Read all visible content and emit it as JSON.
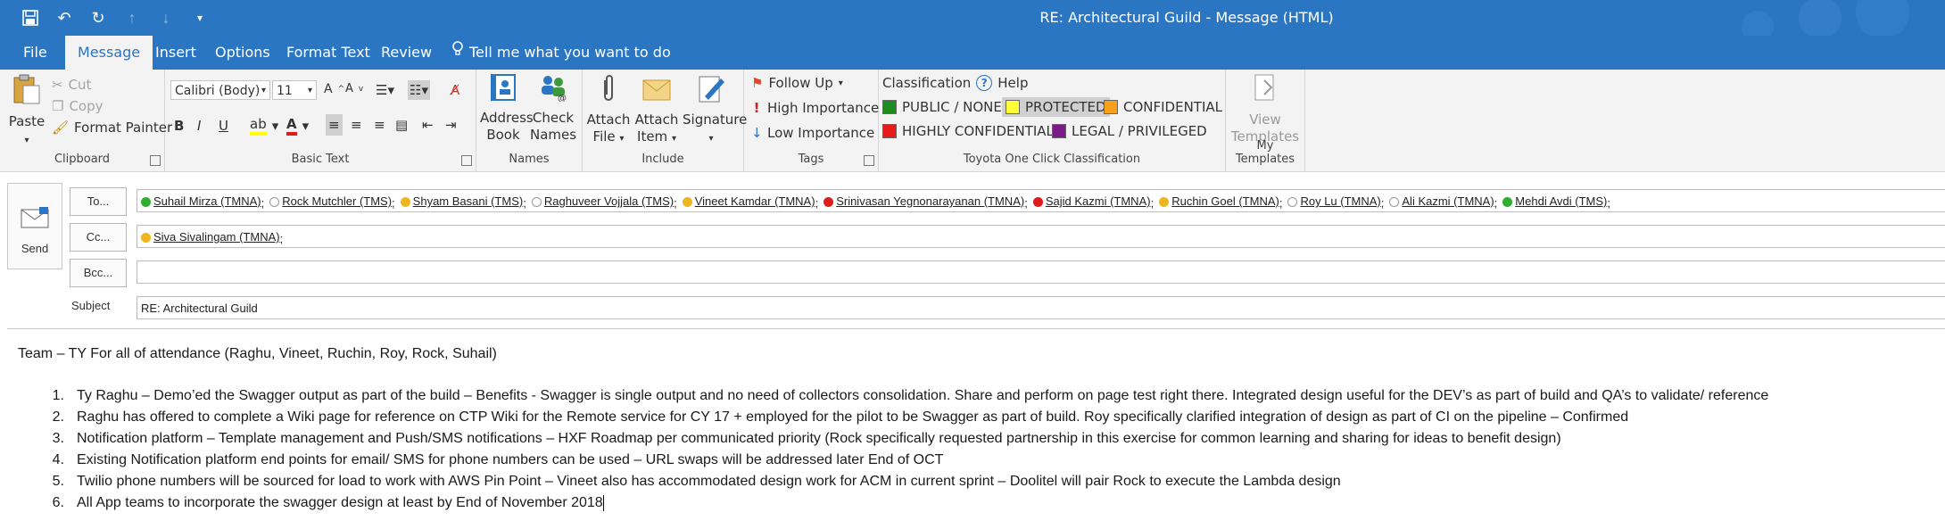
{
  "window": {
    "title": "RE: Architectural Guild  -  Message (HTML)"
  },
  "tabs": [
    "File",
    "Message",
    "Insert",
    "Options",
    "Format Text",
    "Review"
  ],
  "tell_me": "Tell me what you want to do",
  "ribbon": {
    "clipboard": {
      "paste": "Paste",
      "cut": "Cut",
      "copy": "Copy",
      "format_painter": "Format Painter",
      "label": "Clipboard"
    },
    "basic_text": {
      "font": "Calibri (Body)",
      "size": "11",
      "label": "Basic Text"
    },
    "names": {
      "address_book_1": "Address",
      "address_book_2": "Book",
      "check_names_1": "Check",
      "check_names_2": "Names",
      "label": "Names"
    },
    "include": {
      "attach_file_1": "Attach",
      "attach_file_2": "File",
      "attach_item_1": "Attach",
      "attach_item_2": "Item",
      "signature": "Signature",
      "label": "Include"
    },
    "tags": {
      "follow_up": "Follow Up",
      "high": "High Importance",
      "low": "Low Importance",
      "label": "Tags"
    },
    "classification": {
      "title": "Classification",
      "help": "Help",
      "public": "PUBLIC / NONE",
      "protected": "PROTECTED",
      "confidential": "CONFIDENTIAL",
      "highly": "HIGHLY CONFIDENTIAL",
      "legal": "LEGAL / PRIVILEGED",
      "label": "Toyota One Click Classification",
      "colors": {
        "public": "#1f8a1f",
        "protected": "#ffff33",
        "confidential": "#f7a11a",
        "highly": "#e81b1b",
        "legal": "#7a1c86"
      }
    },
    "templates": {
      "view_1": "View",
      "view_2": "Templates",
      "label": "My Templates"
    }
  },
  "compose": {
    "send": "Send",
    "to": "To...",
    "cc": "Cc...",
    "bcc": "Bcc...",
    "subject_label": "Subject",
    "to_recipients": [
      {
        "name": "Suhail Mirza (TMNA)",
        "status": "available"
      },
      {
        "name": "Rock Mutchler (TMS)",
        "status": "offline"
      },
      {
        "name": "Shyam Basani (TMS)",
        "status": "away"
      },
      {
        "name": "Raghuveer Vojjala (TMS)",
        "status": "offline"
      },
      {
        "name": "Vineet Kamdar (TMNA)",
        "status": "away"
      },
      {
        "name": "Srinivasan Yegnonarayanan (TMNA)",
        "status": "busy"
      },
      {
        "name": "Sajid Kazmi (TMNA)",
        "status": "busy"
      },
      {
        "name": "Ruchin Goel (TMNA)",
        "status": "away"
      },
      {
        "name": "Roy Lu (TMNA)",
        "status": "offline"
      },
      {
        "name": "Ali Kazmi (TMNA)",
        "status": "offline"
      },
      {
        "name": "Mehdi Avdi (TMS)",
        "status": "available"
      }
    ],
    "cc_recipients": [
      {
        "name": "Siva Sivalingam (TMNA)",
        "status": "away"
      }
    ],
    "subject": "RE: Architectural Guild"
  },
  "body": {
    "greeting": "Team – TY For all of attendance (Raghu, Vineet, Ruchin, Roy, Rock, Suhail)",
    "items": [
      "Ty Raghu – Demo’ed the Swagger output as part of the build – Benefits - Swagger is single output and no need of collectors consolidation. Share and perform on page test right there. Integrated design useful for the DEV’s as part of build and QA’s to validate/ reference",
      "Raghu has offered to complete a Wiki page for reference on CTP Wiki for the Remote service for CY 17 + employed for the pilot to be Swagger as part of build. Roy specifically clarified integration of design as part of CI on the pipeline – Confirmed",
      "Notification platform – Template management and Push/SMS notifications – HXF Roadmap per communicated priority (Rock specifically requested partnership in this exercise for common learning and sharing for ideas to benefit design)",
      "Existing Notification platform end points for email/ SMS for phone numbers can be used – URL swaps will be addressed later End of OCT",
      "Twilio phone numbers will be sourced for load to work with AWS Pin Point – Vineet also has accommodated design work for ACM in current sprint – Doolitel will pair Rock to execute the Lambda design",
      "All App teams to incorporate the swagger design at least by End of November 2018"
    ]
  },
  "status_colors": {
    "available": "#2fae2f",
    "busy": "#e11b1b",
    "away": "#f0b41c",
    "offline": "#ffffff"
  }
}
